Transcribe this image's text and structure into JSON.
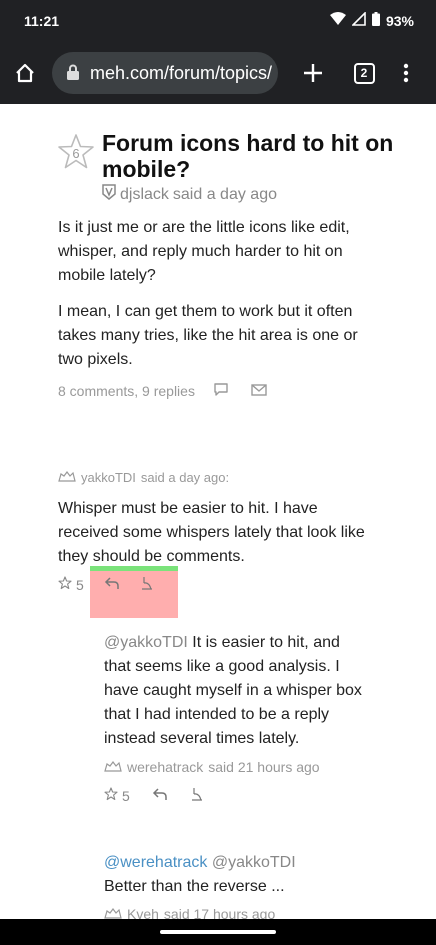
{
  "status": {
    "time": "11:21",
    "battery": "93%"
  },
  "browser": {
    "url": "meh.com/forum/topics/",
    "tab_count": "2"
  },
  "topic": {
    "star_count": "6",
    "title": "Forum icons hard to hit on mobile?",
    "author": "djslack",
    "said": "said a day ago",
    "paragraphs": [
      "Is it just me or are the little icons like edit, whisper, and reply much harder to hit on mobile lately?",
      "I mean, I can get them to work but it often takes many tries, like the hit area is one or two pixels."
    ],
    "comments_meta": "8 comments, 9 replies"
  },
  "comments": [
    {
      "author": "yakkoTDI",
      "said": "said a day ago:",
      "body": "Whisper must be easier to hit. I have received some whispers lately that look like they should be comments.",
      "stars": "5"
    },
    {
      "mention": "@yakkoTDI",
      "body": " It is easier to hit, and that seems like a good analysis. I have caught myself in a whisper box that I had intended to be a reply instead several times lately.",
      "author": "werehatrack",
      "said": "said 21 hours ago",
      "stars": "5"
    },
    {
      "mention1": "@werehatrack",
      "mention2": " @yakkoTDI",
      "body": "Better than the reverse ...",
      "author": "Kveh",
      "said": "said 17 hours ago"
    }
  ]
}
